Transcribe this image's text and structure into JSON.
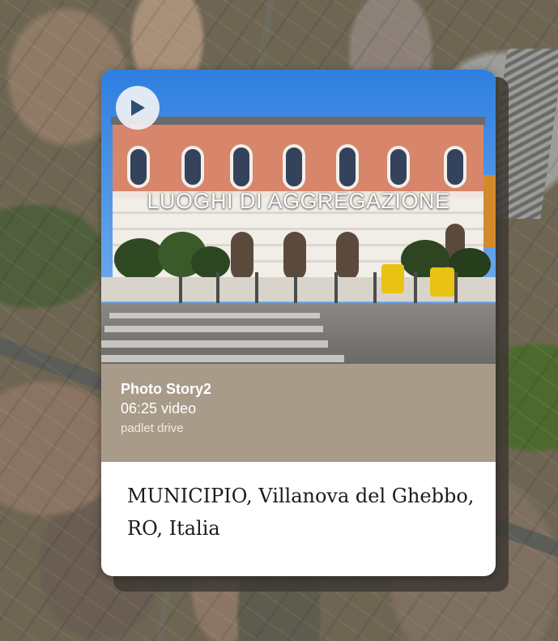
{
  "map": {
    "background": "satellite-map"
  },
  "card": {
    "photo_overlay_title": "LUOGHI DI AGGREGAZIONE",
    "play_icon": "play-icon",
    "attachment": {
      "title": "Photo Story2",
      "subtitle": "06:25 video",
      "source": "padlet drive"
    },
    "caption": "MUNICIPIO, Villanova del Ghebbo, RO, Italia"
  },
  "colors": {
    "info_panel": "#a89b89",
    "card_bg": "#ffffff",
    "caption_text": "#1b1b1b",
    "play_icon": "#2f4e73"
  }
}
